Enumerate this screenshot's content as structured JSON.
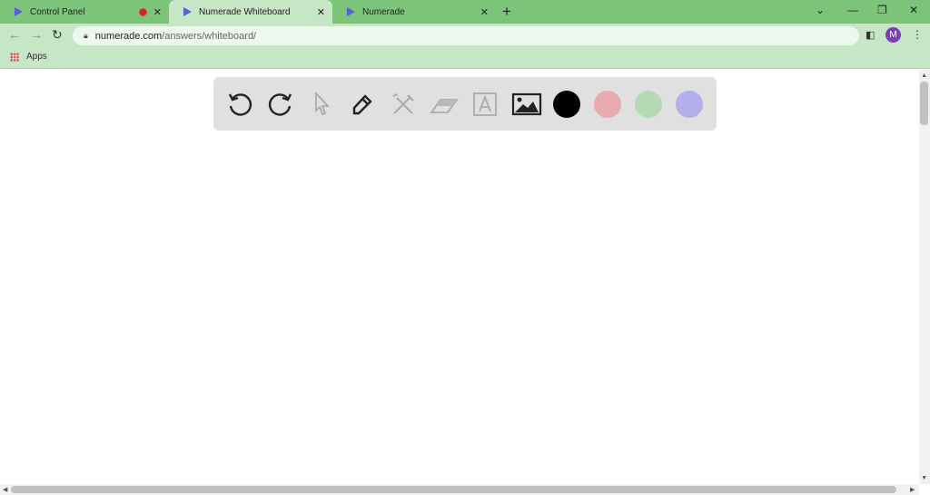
{
  "tabs": [
    {
      "title": "Control Panel",
      "recording": true
    },
    {
      "title": "Numerade Whiteboard",
      "active": true
    },
    {
      "title": "Numerade"
    }
  ],
  "address": {
    "host": "numerade.com",
    "path": "/answers/whiteboard/"
  },
  "profile_initial": "M",
  "bookmarks": {
    "apps_label": "Apps"
  },
  "toolbar": {
    "tools": [
      "undo-icon",
      "redo-icon",
      "select-icon",
      "pen-icon",
      "tools-icon",
      "eraser-icon",
      "text-icon",
      "image-icon"
    ],
    "disabled": [
      "select-icon",
      "tools-icon",
      "eraser-icon",
      "text-icon"
    ],
    "colors": [
      "#000000",
      "#e8a9b0",
      "#b6d9b5",
      "#b4aeea"
    ]
  },
  "accent": "#7cc47a"
}
